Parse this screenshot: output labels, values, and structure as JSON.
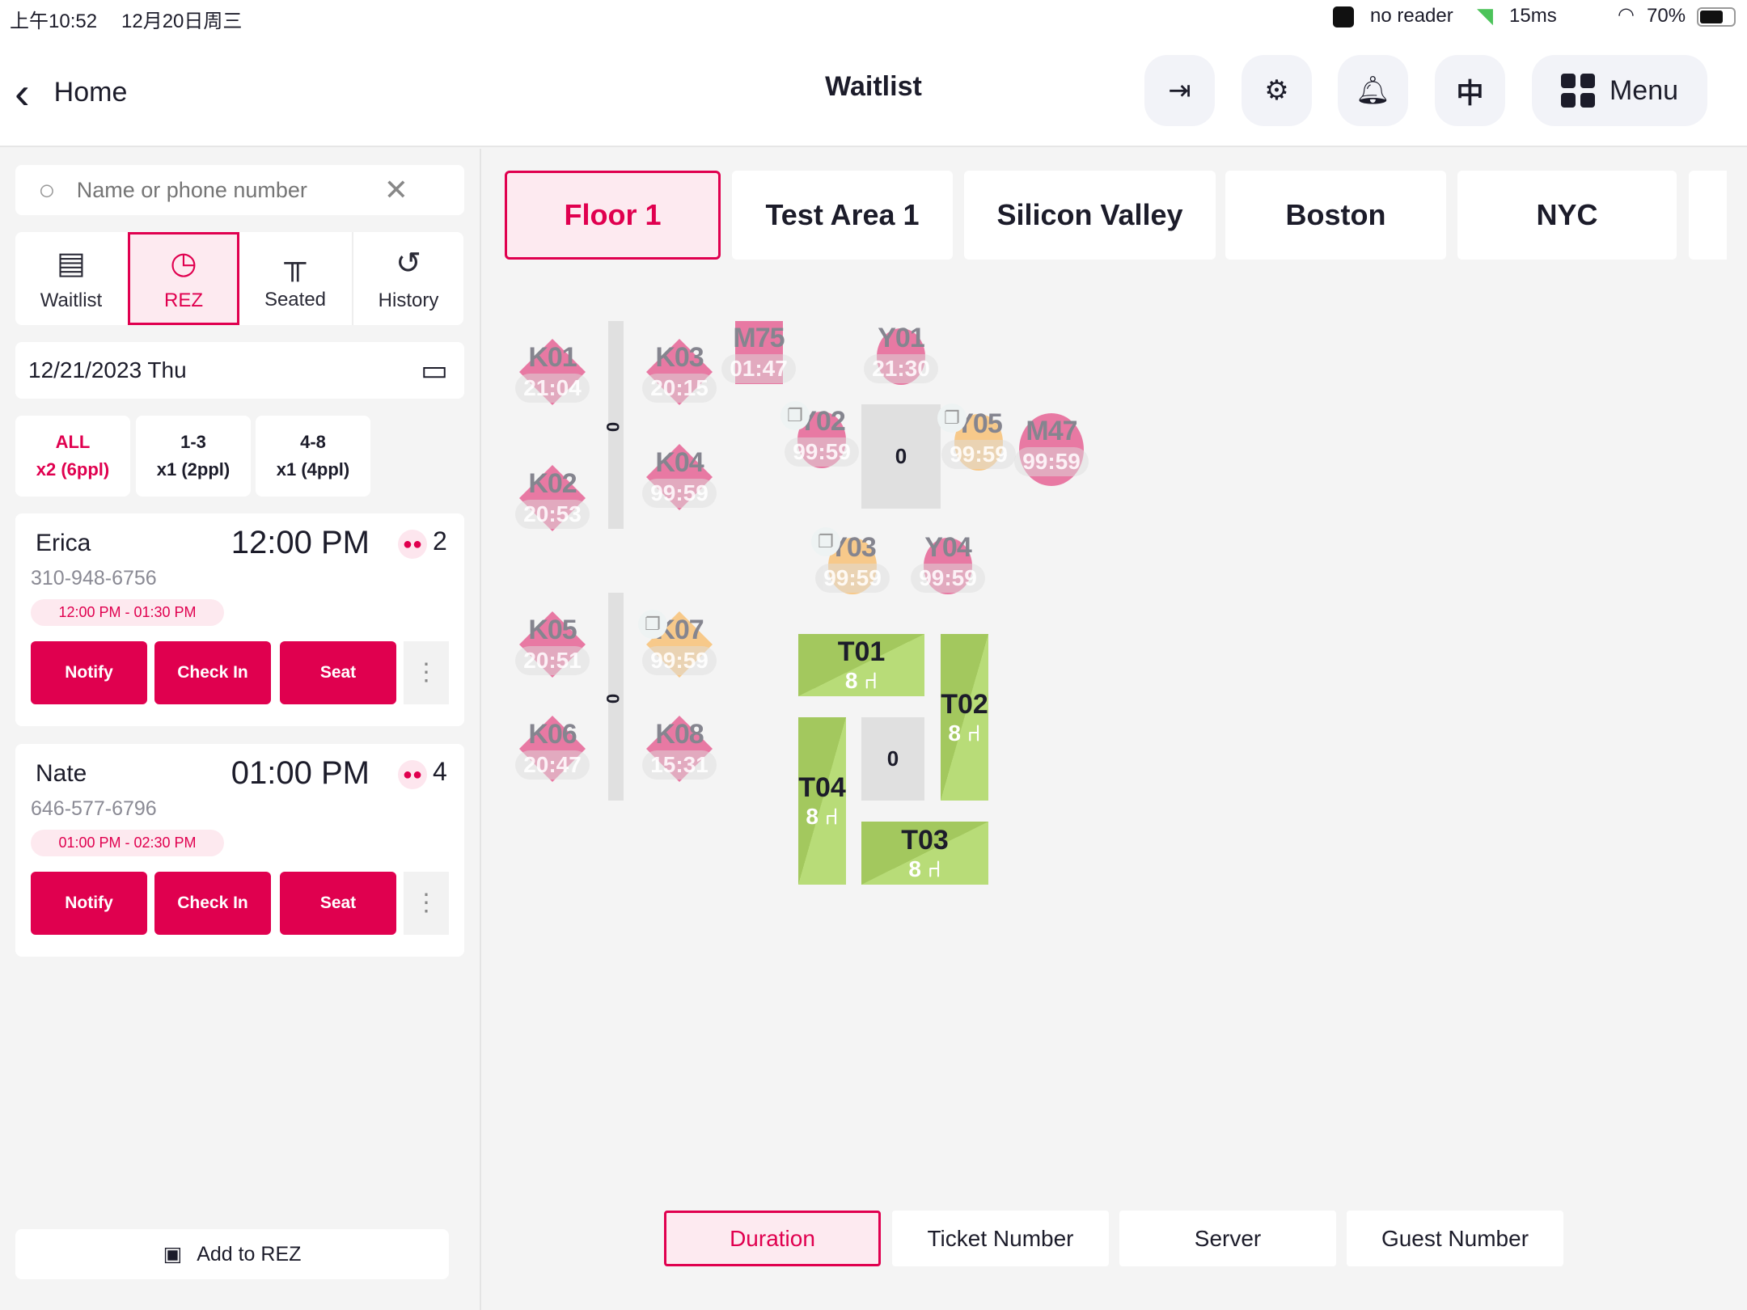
{
  "status": {
    "time": "上午10:52",
    "date": "12月20日周三",
    "reader": "no reader",
    "latency": "15ms",
    "battery": "70%"
  },
  "header": {
    "back": "Home",
    "title": "Waitlist",
    "lang": "中",
    "menu": "Menu"
  },
  "search": {
    "placeholder": "Name or phone number"
  },
  "tabs": [
    {
      "label": "Waitlist"
    },
    {
      "label": "REZ"
    },
    {
      "label": "Seated"
    },
    {
      "label": "History"
    }
  ],
  "date": "12/21/2023 Thu",
  "filters": [
    {
      "range": "ALL",
      "count": "x2 (6ppl)"
    },
    {
      "range": "1-3",
      "count": "x1 (2ppl)"
    },
    {
      "range": "4-8",
      "count": "x1 (4ppl)"
    }
  ],
  "reservations": [
    {
      "name": "Erica",
      "time": "12:00 PM",
      "party": "2",
      "phone": "310-948-6756",
      "window": "12:00 PM - 01:30 PM"
    },
    {
      "name": "Nate",
      "time": "01:00 PM",
      "party": "4",
      "phone": "646-577-6796",
      "window": "01:00 PM - 02:30 PM"
    }
  ],
  "actions": {
    "notify": "Notify",
    "checkin": "Check In",
    "seat": "Seat"
  },
  "add_rez": "Add to REZ",
  "floors": [
    "Floor 1",
    "Test Area 1",
    "Silicon Valley",
    "Boston",
    "NYC"
  ],
  "colors": {
    "accent": "#e0004f",
    "occupied": "#e879a3",
    "pending": "#f7c98a",
    "available": "#b8dc78"
  },
  "tables": [
    {
      "label": "K01",
      "timer": "21:04",
      "shape": "diamond",
      "status": "occupied"
    },
    {
      "label": "K02",
      "timer": "20:53",
      "shape": "diamond",
      "status": "occupied"
    },
    {
      "label": "K03",
      "timer": "20:15",
      "shape": "diamond",
      "status": "occupied"
    },
    {
      "label": "K04",
      "timer": "99:59",
      "shape": "diamond",
      "status": "occupied"
    },
    {
      "label": "K05",
      "timer": "20:51",
      "shape": "diamond",
      "status": "occupied"
    },
    {
      "label": "K06",
      "timer": "20:47",
      "shape": "diamond",
      "status": "occupied"
    },
    {
      "label": "K07",
      "timer": "99:59",
      "shape": "diamond",
      "status": "pending",
      "badge": true
    },
    {
      "label": "K08",
      "timer": "15:31",
      "shape": "diamond",
      "status": "occupied"
    },
    {
      "label": "M75",
      "timer": "01:47",
      "shape": "rect",
      "status": "occupied"
    },
    {
      "label": "Y01",
      "timer": "21:30",
      "shape": "circle",
      "status": "occupied"
    },
    {
      "label": "Y02",
      "timer": "99:59",
      "shape": "circle",
      "status": "occupied",
      "badge": true
    },
    {
      "label": "Y05",
      "timer": "99:59",
      "shape": "circle",
      "status": "pending",
      "badge": true
    },
    {
      "label": "M47",
      "timer": "99:59",
      "shape": "circle",
      "status": "occupied"
    },
    {
      "label": "Y03",
      "timer": "99:59",
      "shape": "circle",
      "status": "pending",
      "badge": true
    },
    {
      "label": "Y04",
      "timer": "99:59",
      "shape": "circle",
      "status": "occupied"
    }
  ],
  "open_tables": [
    {
      "label": "T01",
      "seats": "8"
    },
    {
      "label": "T02",
      "seats": "8"
    },
    {
      "label": "T03",
      "seats": "8"
    },
    {
      "label": "T04",
      "seats": "8"
    }
  ],
  "zones": [
    "0",
    "0",
    "0",
    "0"
  ],
  "views": [
    "Duration",
    "Ticket Number",
    "Server",
    "Guest Number"
  ]
}
